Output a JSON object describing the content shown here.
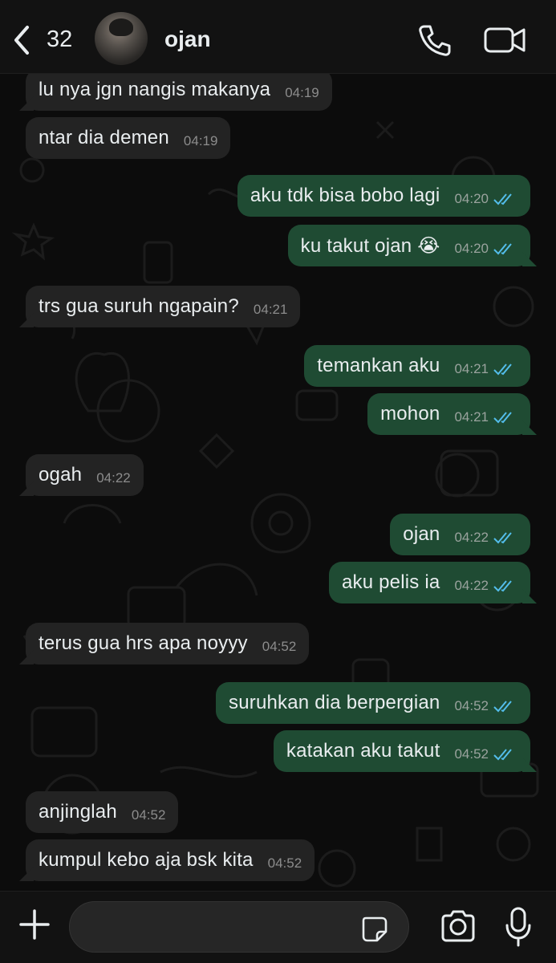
{
  "header": {
    "back_count": "32",
    "contact_name": "ojan"
  },
  "messages": [
    {
      "dir": "in",
      "text": "lu nya jgn nangis makanya",
      "time": "04:19"
    },
    {
      "dir": "in",
      "text": "ntar dia demen",
      "time": "04:19"
    },
    {
      "dir": "out",
      "text": "aku tdk bisa bobo lagi",
      "time": "04:20"
    },
    {
      "dir": "out",
      "text": "ku takut ojan 😭",
      "time": "04:20"
    },
    {
      "dir": "in",
      "text": "trs gua suruh ngapain?",
      "time": "04:21"
    },
    {
      "dir": "out",
      "text": "temankan aku",
      "time": "04:21"
    },
    {
      "dir": "out",
      "text": "mohon",
      "time": "04:21"
    },
    {
      "dir": "in",
      "text": "ogah",
      "time": "04:22"
    },
    {
      "dir": "out",
      "text": "ojan",
      "time": "04:22"
    },
    {
      "dir": "out",
      "text": "aku pelis ia",
      "time": "04:22"
    },
    {
      "dir": "in",
      "text": "terus gua hrs apa noyyy",
      "time": "04:52"
    },
    {
      "dir": "out",
      "text": "suruhkan dia berpergian",
      "time": "04:52"
    },
    {
      "dir": "out",
      "text": "katakan aku takut",
      "time": "04:52"
    },
    {
      "dir": "in",
      "text": "anjinglah",
      "time": "04:52"
    },
    {
      "dir": "in",
      "text": "kumpul kebo aja bsk kita",
      "time": "04:52"
    }
  ],
  "colors": {
    "incoming_bubble": "#232323",
    "outgoing_bubble": "#1f4b33",
    "read_ticks": "#53bdeb"
  },
  "icons": [
    "chevron-left-icon",
    "phone-icon",
    "video-camera-icon",
    "plus-icon",
    "sticker-icon",
    "camera-icon",
    "microphone-icon"
  ]
}
